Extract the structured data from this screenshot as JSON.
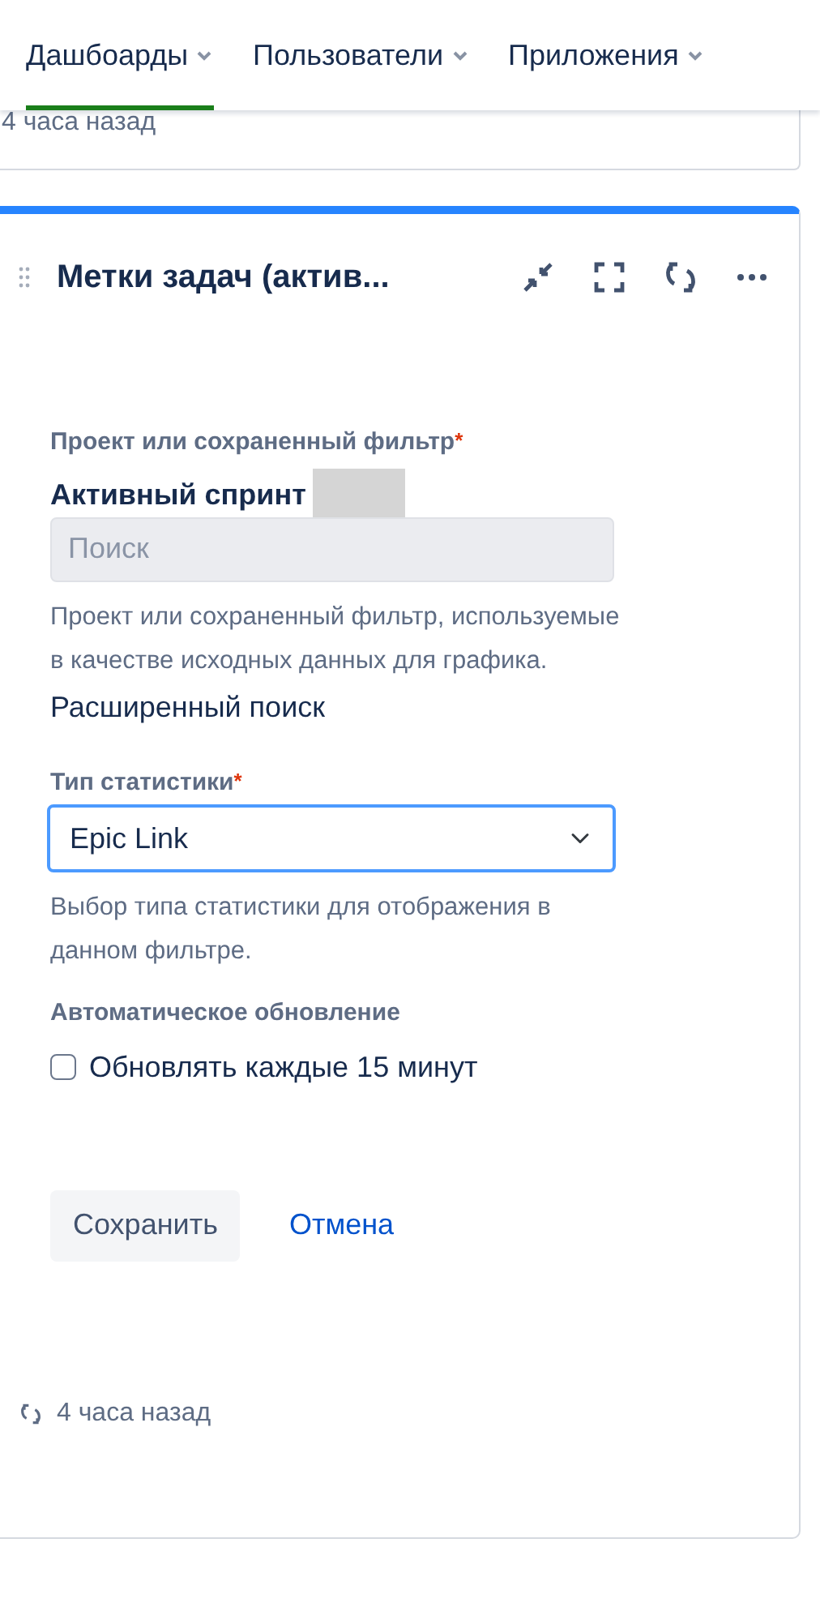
{
  "nav": [
    {
      "label": "Дашбоарды",
      "selected": true
    },
    {
      "label": "Пользователи",
      "selected": false
    },
    {
      "label": "Приложения",
      "selected": false
    }
  ],
  "previous_gadget": {
    "updated": "4 часа назад"
  },
  "gadget": {
    "title": "Метки задач (актив...",
    "filter_label": "Проект или сохраненный фильтр",
    "filter_required_mark": "*",
    "filter_value": "Активный спринт",
    "search": {
      "placeholder": "Поиск"
    },
    "filter_help": "Проект или сохраненный фильтр, используемые в качестве исходных данных для графика.",
    "advanced_search": "Расширенный поиск",
    "stat_label": "Тип статистики",
    "stat_required_mark": "*",
    "stat_select": {
      "value": "Epic Link",
      "focused": true
    },
    "stat_help": "Выбор типа статистики для отображения в данном фильтре.",
    "refresh_label": "Автоматическое обновление",
    "refresh_option": {
      "label": "Обновлять каждые 15 минут",
      "checked": false
    },
    "buttons": [
      {
        "label": "Сохранить",
        "kind": "secondary"
      },
      {
        "label": "Отмена",
        "kind": "link"
      }
    ],
    "updated": "4 часа назад"
  }
}
